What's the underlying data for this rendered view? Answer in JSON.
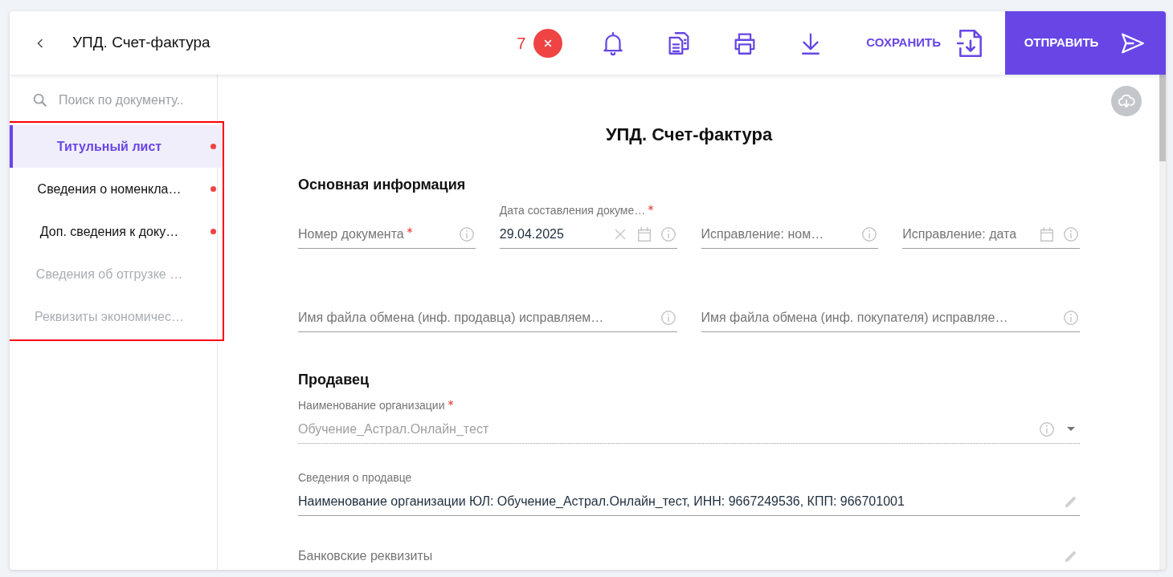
{
  "header": {
    "title": "УПД. Счет-фактура",
    "error_count": "7",
    "save_label": "СОХРАНИТЬ",
    "send_label": "ОТПРАВИТЬ"
  },
  "sidebar": {
    "search": {
      "placeholder": "Поиск по документу.."
    },
    "items": [
      {
        "label": "Титульный лист",
        "selected": true,
        "has_error": true,
        "disabled": false
      },
      {
        "label": "Сведения о номенкла…",
        "selected": false,
        "has_error": true,
        "disabled": false
      },
      {
        "label": "Доп. сведения к доку…",
        "selected": false,
        "has_error": true,
        "disabled": false
      },
      {
        "label": "Сведения об отгрузке …",
        "selected": false,
        "has_error": false,
        "disabled": true
      },
      {
        "label": "Реквизиты экономичес…",
        "selected": false,
        "has_error": false,
        "disabled": true
      }
    ]
  },
  "document": {
    "title": "УПД. Счет-фактура",
    "sections": [
      {
        "title": "Основная информация",
        "fields": [
          {
            "kind": "text",
            "label": "Номер документа",
            "required": true
          },
          {
            "kind": "date",
            "label": "Дата составления докуме…",
            "required": true,
            "value": "29.04.2025"
          },
          {
            "kind": "text",
            "label": "Исправление: ном…",
            "required": false
          },
          {
            "kind": "date",
            "label": "Исправление: дата",
            "required": false
          }
        ]
      },
      {
        "fields": [
          {
            "kind": "text",
            "label": "Имя файла обмена (инф. продавца) исправляем…",
            "required": false
          },
          {
            "kind": "text",
            "label": "Имя файла обмена (инф. покупателя) исправляе…",
            "required": false
          }
        ]
      },
      {
        "title": "Продавец",
        "fields": [
          {
            "kind": "select",
            "label": "Наименование организации",
            "required": true,
            "value": "Обучение_Астрал.Онлайн_тест",
            "disabled": true
          }
        ]
      },
      {
        "fields": [
          {
            "kind": "readonly",
            "label": "Сведения о продавце",
            "required": false,
            "value": "Наименование организации ЮЛ: Обучение_Астрал.Онлайн_тест, ИНН: 9667249536, КПП: 966701001"
          }
        ]
      },
      {
        "fields": [
          {
            "kind": "readonly",
            "label": "Банковские реквизиты",
            "required": false
          }
        ]
      }
    ]
  }
}
